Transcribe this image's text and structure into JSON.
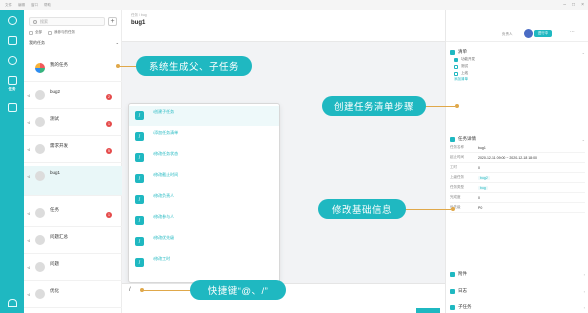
{
  "menubar": {
    "items": [
      "文件",
      "编辑",
      "窗口",
      "帮助"
    ]
  },
  "rail": {
    "items": [
      {
        "label": "",
        "icon": "logo-icon"
      },
      {
        "label": "",
        "icon": "chat-icon"
      },
      {
        "label": "",
        "icon": "contacts-icon"
      },
      {
        "label": "任务",
        "icon": "task-icon"
      },
      {
        "label": "",
        "icon": "app-icon"
      }
    ]
  },
  "list": {
    "search_placeholder": "搜索",
    "filter_1": "全部",
    "filter_2": "我参与的任务",
    "group_title": "我的任务",
    "group_count": "",
    "tasks": [
      {
        "name": "我的任务",
        "sub": "",
        "badge": "",
        "meta": ""
      },
      {
        "name": "bug2",
        "sub": "",
        "badge": "2",
        "meta": ""
      },
      {
        "name": "测试",
        "sub": "",
        "badge": "1",
        "meta": ""
      },
      {
        "name": "需求开发",
        "sub": "",
        "badge": "5",
        "meta": ""
      },
      {
        "name": "bug1",
        "sub": "",
        "badge": "",
        "meta": ""
      },
      {
        "name": "任务",
        "sub": "",
        "badge": "1",
        "meta": ""
      },
      {
        "name": "问题汇总",
        "sub": "",
        "badge": "",
        "meta": ""
      },
      {
        "name": "问题",
        "sub": "",
        "badge": "",
        "meta": ""
      },
      {
        "name": "优化",
        "sub": "",
        "badge": "",
        "meta": ""
      }
    ]
  },
  "main": {
    "breadcrumb": "任务 / bug",
    "title": "bug1",
    "tag": ""
  },
  "popup": {
    "items": [
      {
        "label": "/创建子任务",
        "desc": ""
      },
      {
        "label": "/添加任务清单",
        "desc": ""
      },
      {
        "label": "/修改任务状态",
        "desc": ""
      },
      {
        "label": "/修改截止时间",
        "desc": ""
      },
      {
        "label": "/修改负责人",
        "desc": ""
      },
      {
        "label": "/修改参与人",
        "desc": ""
      },
      {
        "label": "/修改优先级",
        "desc": ""
      },
      {
        "label": "/修改工时",
        "desc": ""
      }
    ]
  },
  "input": {
    "slash": "/"
  },
  "right": {
    "assignee": "负责人",
    "status": "进行中",
    "checklist_title": "清单",
    "checklist_items": [
      {
        "text": "功能开发",
        "checked": true
      },
      {
        "text": "测试",
        "checked": false
      },
      {
        "text": "上线",
        "checked": false
      }
    ],
    "checklist_add": "添加清单",
    "info_title": "任务详情",
    "fields": [
      {
        "label": "任务名称",
        "value": "bug1"
      },
      {
        "label": "起止时间",
        "value": "2020-12-11 09:00  ~  2020-12-18 18:00"
      },
      {
        "label": "工时",
        "value": "0"
      },
      {
        "label": "上级任务",
        "value": "bug2"
      },
      {
        "label": "任务类型",
        "value": "bug"
      },
      {
        "label": "完成度",
        "value": "0"
      },
      {
        "label": "优先级",
        "value": "P0"
      }
    ],
    "attach_title": "附件",
    "log_title": "日志",
    "sub_title": "子任务"
  },
  "callouts": {
    "c1": "系统生成父、子任务",
    "c2": "创建任务清单步骤",
    "c3": "修改基础信息",
    "c4": "快捷键“@、/”"
  },
  "colors": {
    "accent": "#1fb8c1",
    "callout_line": "#e0a84a",
    "badge": "#e54b4b"
  }
}
